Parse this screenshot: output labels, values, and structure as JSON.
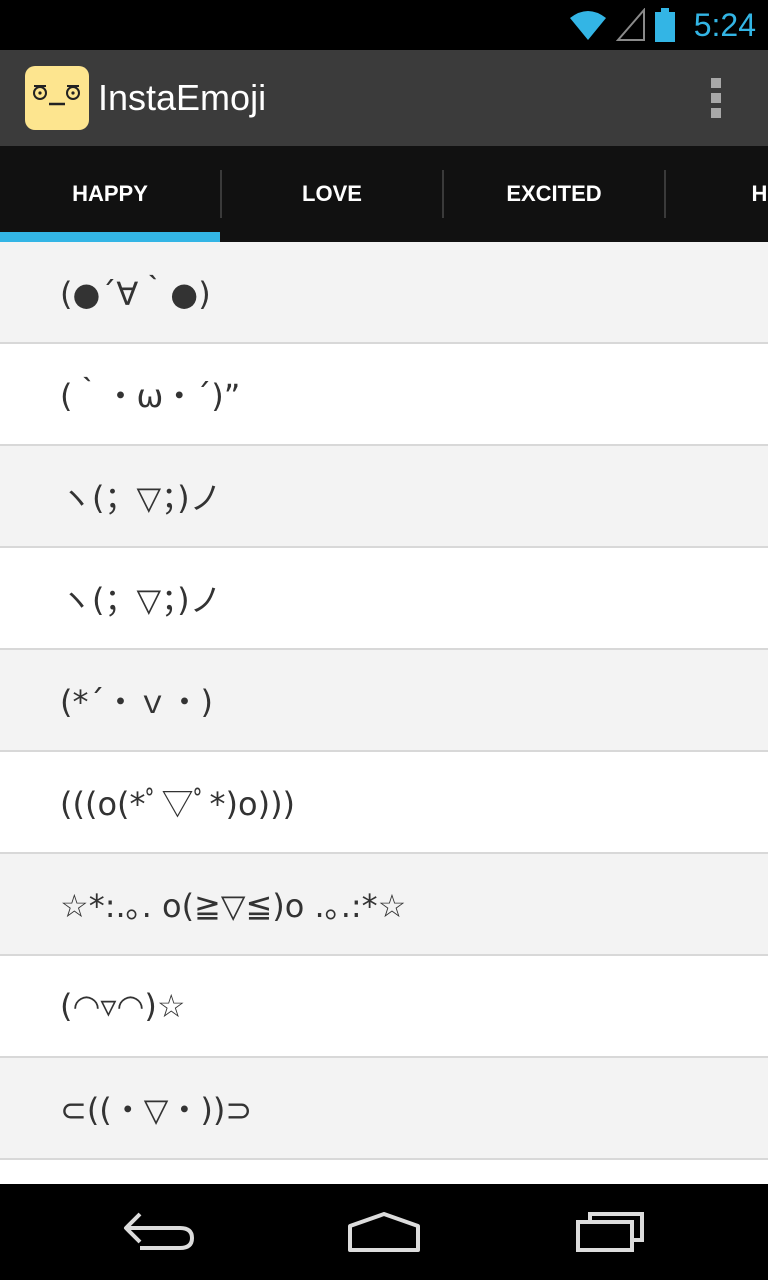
{
  "status_bar": {
    "time": "5:24",
    "icons": [
      "wifi-icon",
      "signal-icon",
      "battery-icon"
    ],
    "accent": "#33b5e5"
  },
  "action_bar": {
    "title": "InstaEmoji",
    "app_icon": "app-logo-icon",
    "overflow": "overflow-menu-icon"
  },
  "tabs": [
    {
      "label": "HAPPY",
      "selected": true
    },
    {
      "label": "LOVE",
      "selected": false
    },
    {
      "label": "EXCITED",
      "selected": false
    },
    {
      "label": "HUG",
      "selected": false
    }
  ],
  "emoticons": [
    "(●´∀｀●)",
    "(｀・ω・´)”",
    "ヽ(；▽；)ノ",
    "ヽ(；▽；)ノ",
    "(*´・ｖ・)",
    "(((o(*ﾟ▽ﾟ*)o)))",
    "☆*:.｡. o(≧▽≦)o .｡.:*☆",
    "(◠▿◠)☆",
    "⊂((・▽・))⊃",
    ""
  ],
  "nav_bar": {
    "buttons": [
      "back-icon",
      "home-icon",
      "recent-apps-icon"
    ]
  },
  "colors": {
    "accent": "#33b5e5",
    "action_bar": "#3b3b3b",
    "tab_bar": "#111111"
  }
}
